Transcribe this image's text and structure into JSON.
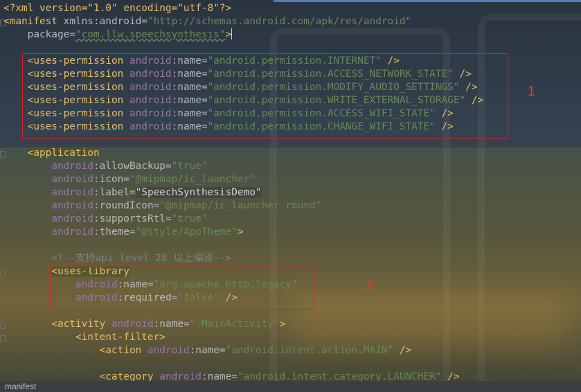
{
  "editor": {
    "xml_decl": "<?xml version=\"1.0\" encoding=\"utf-8\"?>",
    "manifest_open": "<manifest",
    "xmlns_name": "xmlns:android",
    "xmlns_value": "\"http://schemas.android.com/apk/res/android\"",
    "package_name": "package",
    "package_value": "\"com.llw.speechsynthesis\"",
    "package_close": ">",
    "permission_tag": "<uses-permission",
    "permissions": [
      "\"android.permission.INTERNET\"",
      "\"android.permission.ACCESS_NETWORK_STATE\"",
      "\"android.permission.MODIFY_AUDIO_SETTINGS\"",
      "\"android.permission.WRITE_EXTERNAL_STORAGE\"",
      "\"android.permission.ACCESS_WIFI_STATE\"",
      "\"android.permission.CHANGE_WIFI_STATE\""
    ],
    "application_tag": "<application",
    "application_attrs": [
      {
        "name": "allowBackup",
        "value": "\"true\""
      },
      {
        "name": "icon",
        "value": "\"@mipmap/ic_launcher\""
      },
      {
        "name": "label",
        "value": "\"SpeechSynthesisDemo\""
      },
      {
        "name": "roundIcon",
        "value": "\"@mipmap/ic_launcher_round\""
      },
      {
        "name": "supportsRtl",
        "value": "\"true\""
      },
      {
        "name": "theme",
        "value": "\"@style/AppTheme\""
      }
    ],
    "comment": "<!--支持api level 28 以上编译-->",
    "uses_library_tag": "<uses-library",
    "library_name": "\"org.apache.http.legacy\"",
    "library_required": "\"false\"",
    "activity_tag": "<activity",
    "activity_name": "\".MainActivity\"",
    "intent_filter_tag": "<intent-filter>",
    "action_tag": "<action",
    "action_name": "\"android.intent.action.MAIN\"",
    "category_tag": "<category",
    "category_name": "\"android.intent.category.LAUNCHER\"",
    "ns": "android",
    "name_attr": "name",
    "required_attr": "required",
    "self_close": "/>",
    "close": ">"
  },
  "annotations": {
    "box1": "1",
    "box2": "2"
  },
  "statusbar": {
    "breadcrumb": "manifest"
  },
  "colors": {
    "highlight_box": "#e02020",
    "tag": "#e8bf6a",
    "value": "#6a8759",
    "namespace": "#9876aa"
  }
}
